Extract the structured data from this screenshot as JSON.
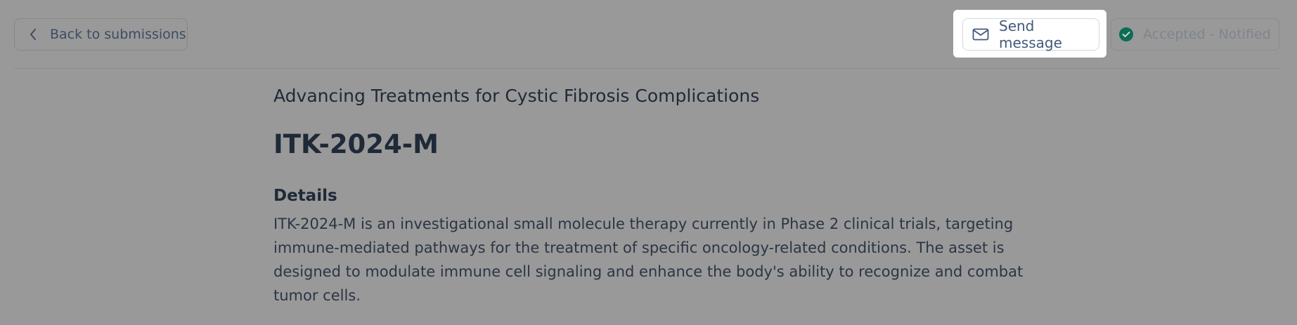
{
  "header": {
    "back_label": "Back to submissions",
    "send_label": "Send message",
    "status_label": "Accepted - Notified"
  },
  "submission": {
    "subtitle": "Advancing Treatments for Cystic Fibrosis Complications",
    "code": "ITK-2024-M",
    "details_heading": "Details",
    "details_text": "ITK-2024-M is an investigational small molecule therapy currently in Phase 2 clinical trials, targeting immune-mediated pathways for the treatment of specific oncology-related conditions. The asset is designed to modulate immune cell signaling and enhance the body's ability to recognize and combat tumor cells."
  },
  "icons": {
    "back": "chevron-left-icon",
    "send": "mail-icon",
    "status": "check-circle-icon"
  },
  "colors": {
    "overlay": "#999999",
    "status_check": "#0e6c55",
    "highlight": "#ffffff"
  }
}
